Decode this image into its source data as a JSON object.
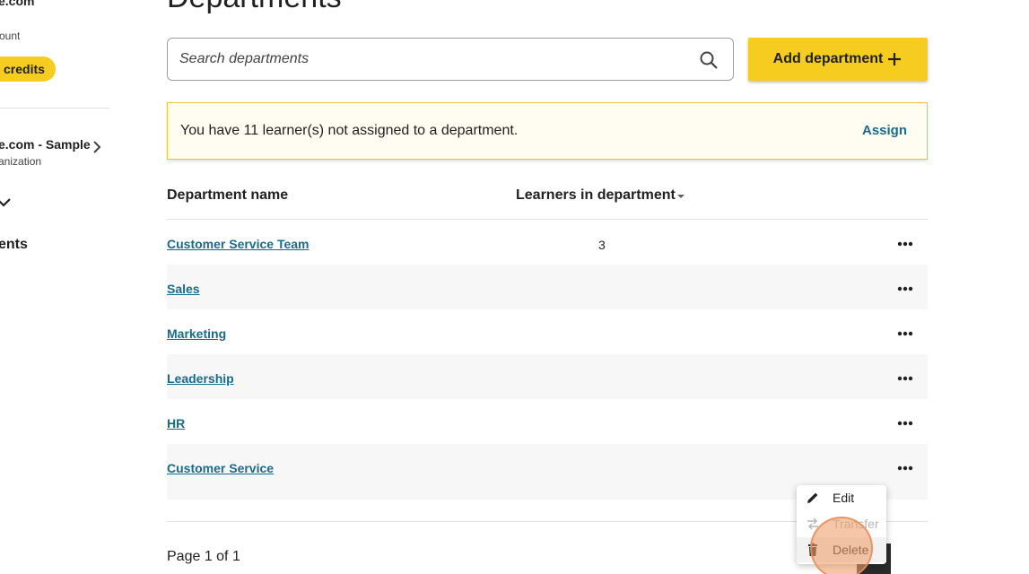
{
  "sidebar": {
    "email": "e.com",
    "account_label": "ount",
    "credits_label": "credits",
    "org_name": "e.com - Sample",
    "org_subtitle": "anization",
    "nav_label": "ents"
  },
  "main": {
    "title": "Departments",
    "search": {
      "placeholder": "Search departments",
      "value": ""
    },
    "add_button_label": "Add department",
    "notice": {
      "text": "You have 11 learner(s) not assigned to a department.",
      "action_label": "Assign"
    },
    "table": {
      "columns": [
        "Department name",
        "Learners in department"
      ],
      "rows": [
        {
          "name": "Customer Service Team",
          "learners": "3"
        },
        {
          "name": "Sales",
          "learners": ""
        },
        {
          "name": "Marketing",
          "learners": ""
        },
        {
          "name": "Leadership",
          "learners": ""
        },
        {
          "name": "HR",
          "learners": ""
        },
        {
          "name": "Customer Service",
          "learners": ""
        }
      ]
    },
    "pagination": "Page 1 of 1"
  },
  "context_menu": {
    "items": [
      {
        "label": "Edit",
        "icon": "pencil-icon",
        "enabled": true
      },
      {
        "label": "Transfer",
        "icon": "swap-arrows-icon",
        "enabled": false
      },
      {
        "label": "Delete",
        "icon": "trash-icon",
        "enabled": true
      }
    ]
  },
  "colors": {
    "accent_yellow": "#f5cc1f",
    "link_teal": "#1a6a8a",
    "notice_border": "#e8c63c"
  }
}
